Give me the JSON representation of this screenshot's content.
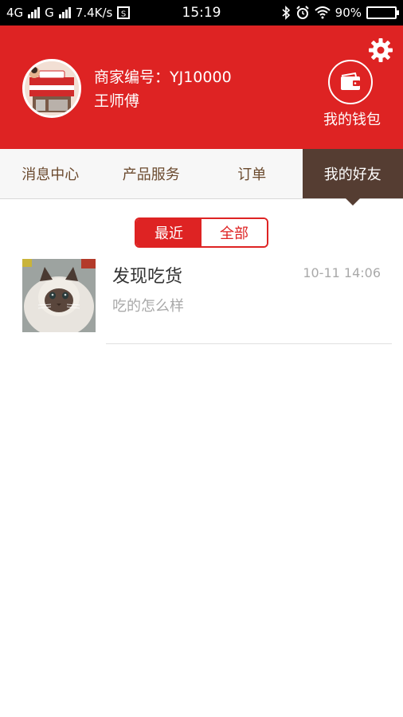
{
  "status_bar": {
    "network1": "4G",
    "network2": "G",
    "speed": "7.4K/s",
    "time": "15:19",
    "battery_percent": "90%",
    "battery_level": 0.9
  },
  "header": {
    "merchant_id": "商家编号：YJ10000",
    "merchant_name": "王师傅",
    "wallet_label": "我的钱包",
    "colors": {
      "brand_red": "#de2323"
    }
  },
  "tabs": [
    {
      "label": "消息中心",
      "active": false
    },
    {
      "label": "产品服务",
      "active": false
    },
    {
      "label": "订单",
      "active": false
    },
    {
      "label": "我的好友",
      "active": true
    }
  ],
  "segment": {
    "options": [
      {
        "label": "最近",
        "active": true
      },
      {
        "label": "全部",
        "active": false
      }
    ]
  },
  "friends": [
    {
      "name": "发现吃货",
      "message": "吃的怎么样",
      "time": "10-11 14:06",
      "avatar_icon": "cat-photo"
    }
  ]
}
